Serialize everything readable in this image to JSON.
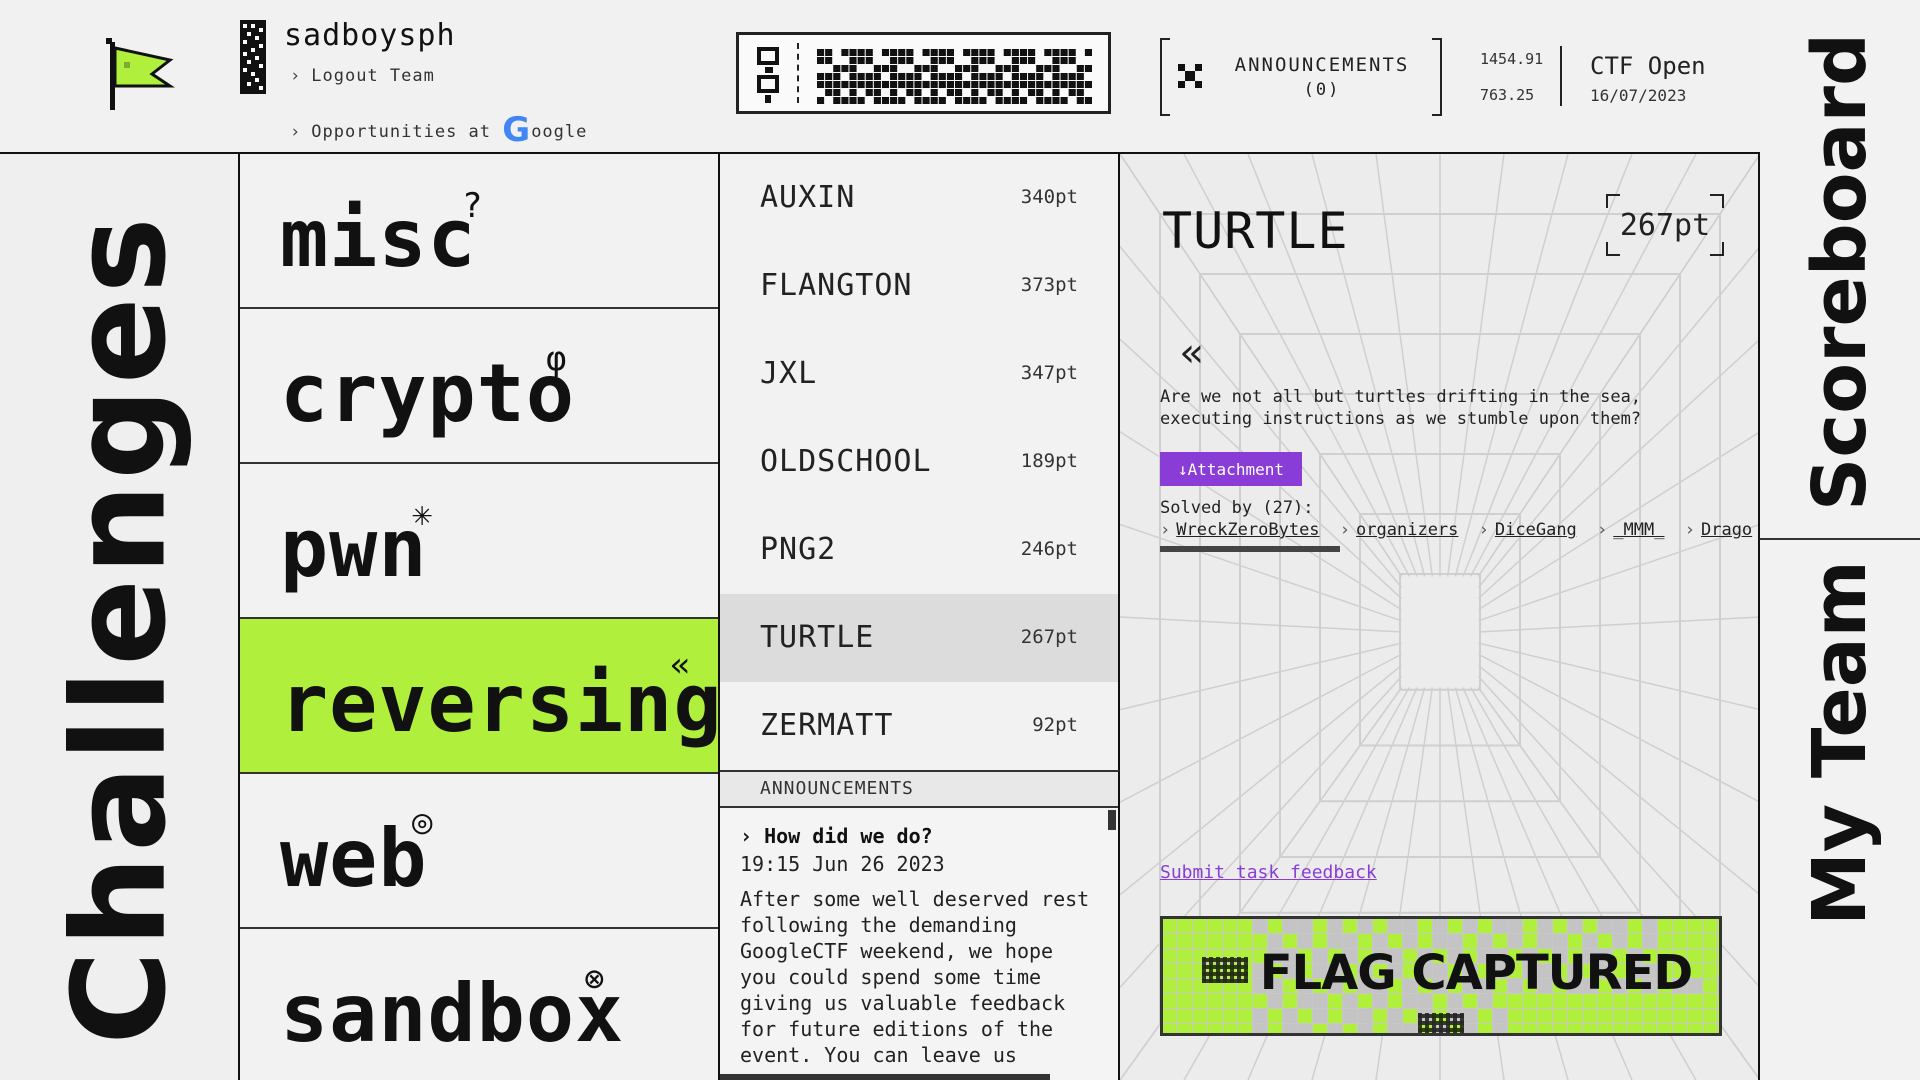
{
  "header": {
    "team_name": "sadboysph",
    "logout_label": "Logout Team",
    "opportunities_label": "Opportunities at",
    "google_g": "G",
    "google_rest": "oogle",
    "announcements_label": "ANNOUNCEMENTS",
    "announcements_count": "(0)",
    "stat_a": "1454.91",
    "stat_b": "763.25",
    "ctf_title": "CTF Open",
    "ctf_date": "16/07/2023"
  },
  "side_title": "Challenges",
  "categories": [
    {
      "label": "misc",
      "sup": "?",
      "active": false
    },
    {
      "label": "crypto",
      "sup": "φ",
      "active": false
    },
    {
      "label": "pwn",
      "sup": "✳",
      "active": false
    },
    {
      "label": "reversing",
      "sup": "«",
      "active": true
    },
    {
      "label": "web",
      "sup": "◎",
      "active": false
    },
    {
      "label": "sandbox",
      "sup": "⊗",
      "active": false
    }
  ],
  "challenges": [
    {
      "name": "AUXIN",
      "points": "340pt",
      "active": false
    },
    {
      "name": "FLANGTON",
      "points": "373pt",
      "active": false
    },
    {
      "name": "JXL",
      "points": "347pt",
      "active": false
    },
    {
      "name": "OLDSCHOOL",
      "points": "189pt",
      "active": false
    },
    {
      "name": "PNG2",
      "points": "246pt",
      "active": false
    },
    {
      "name": "TURTLE",
      "points": "267pt",
      "active": true
    },
    {
      "name": "ZERMATT",
      "points": "92pt",
      "active": false
    }
  ],
  "announcements_panel": {
    "header": "ANNOUNCEMENTS",
    "title": "How did we do?",
    "time": "19:15 Jun 26 2023",
    "body": "After some well deserved rest following the demanding GoogleCTF weekend, we hope you could spend some time giving us valuable feedback for future editions of the event. You can leave us"
  },
  "detail": {
    "title": "TURTLE",
    "points": "267pt",
    "chevron": "«",
    "description": "Are we not all but turtles drifting in the sea, executing instructions as we stumble upon them?",
    "attachment_label": "↓Attachment",
    "solved_label": "Solved by (27):",
    "solvers": [
      "WreckZeroBytes",
      "organizers",
      "DiceGang",
      "_MMM_",
      "Drago"
    ],
    "feedback_label": "Submit task feedback",
    "flag_label": "FLAG CAPTURED"
  },
  "nav": {
    "scoreboard": "Scoreboard",
    "my_team": "My Team"
  },
  "colors": {
    "accent_green": "#b0ef3c",
    "accent_purple": "#8a3dd6",
    "background": "#efefef",
    "ink": "#111111"
  },
  "icons": {
    "logo": "flag-icon",
    "announce": "x-close-icon",
    "detail_chevron": "double-chevron-left-icon"
  }
}
